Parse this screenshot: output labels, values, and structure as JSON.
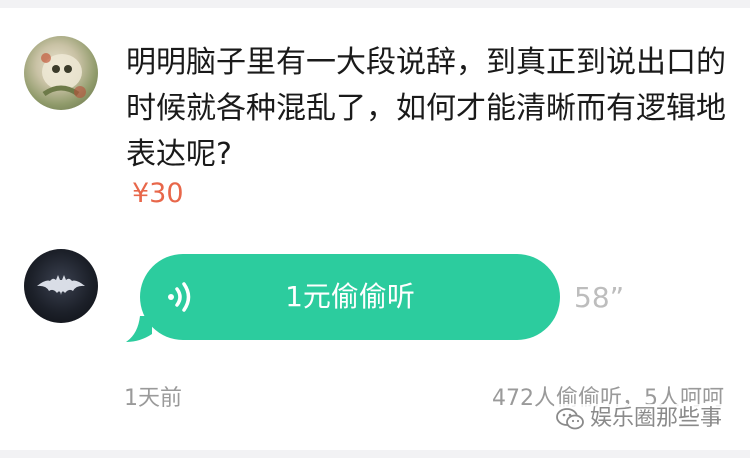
{
  "question": {
    "text": "明明脑子里有一大段说辞，到真正到说出口的时候就各种混乱了，如何才能清晰而有逻辑地表达呢?",
    "price": "¥30"
  },
  "answer": {
    "listen_label": "1元偷偷听",
    "duration": "58”"
  },
  "meta": {
    "time_ago": "1天前",
    "stats": "472人偷偷听，5人呵呵"
  },
  "watermark": {
    "text": "娱乐圈那些事"
  },
  "colors": {
    "accent": "#2ccc9e",
    "price": "#e8674a"
  },
  "icons": {
    "voice": "sound-wave-icon",
    "watermark": "wechat-icon"
  }
}
